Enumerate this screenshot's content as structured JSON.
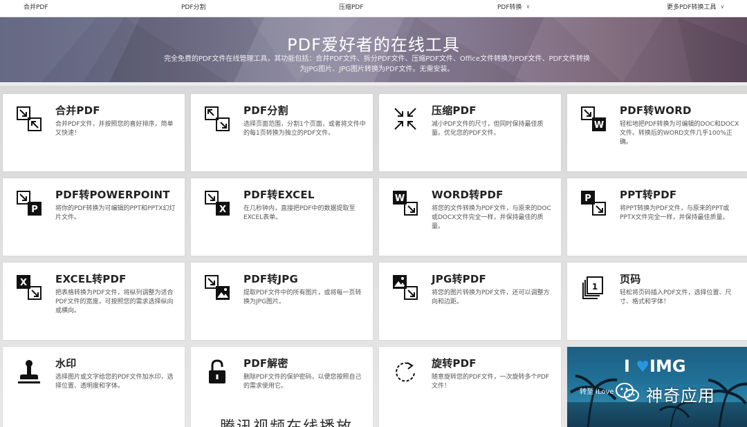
{
  "nav": {
    "items": [
      {
        "label": "合并PDF"
      },
      {
        "label": "PDF分割"
      },
      {
        "label": "压缩PDF"
      },
      {
        "label": "PDF转换"
      },
      {
        "label": "更多PDF转换工具"
      }
    ]
  },
  "hero": {
    "title": "PDF爱好者的在线工具",
    "subtitle": "完全免费的PDF文件在线管理工具，其功能包括：合并PDF文件、拆分PDF文件、压缩PDF文件、Office文件转换为PDF文件、PDF文件转换为JPG图片、JPG图片转换为PDF文件。无需安装。"
  },
  "tools": [
    {
      "title": "合并PDF",
      "desc": "合并PDF文件，并按照您的喜好排序，简单又快速！",
      "icon": "merge-icon"
    },
    {
      "title": "PDF分割",
      "desc": "选择页面范围，分割1个页面，或者将文件中的每1页转换为独立的PDF文件。",
      "icon": "split-icon"
    },
    {
      "title": "压缩PDF",
      "desc": "减小PDF文件的尺寸，但同时保持最佳质量。优化您的PDF文件。",
      "icon": "compress-icon"
    },
    {
      "title": "PDF转WORD",
      "desc": "轻松地把PDF转换为可编辑的DOC和DOCX文件。转换后的WORD文件几乎100%正确。",
      "icon": "word-icon"
    },
    {
      "title": "PDF转POWERPOINT",
      "desc": "将你的PDF转换为可编辑的PPT和PPTX幻灯片文件。",
      "icon": "powerpoint-icon"
    },
    {
      "title": "PDF转EXCEL",
      "desc": "在几秒钟内，直接把PDF中的数据提取至EXCEL表单。",
      "icon": "excel-icon"
    },
    {
      "title": "WORD转PDF",
      "desc": "将您的文件转换为PDF文件，与原来的DOC或DOCX文件完全一样，并保持最佳的质量。",
      "icon": "word-to-pdf-icon"
    },
    {
      "title": "PPT转PDF",
      "desc": "将PPT转换为PDF文件，与原来的PPT或PPTX文件完全一样，并保持最佳质量。",
      "icon": "ppt-to-pdf-icon"
    },
    {
      "title": "EXCEL转PDF",
      "desc": "把表格转换为PDF文件，将纵列调整为适合PDF文件的宽度，可按照您的需求选择纵向或横向。",
      "icon": "excel-to-pdf-icon"
    },
    {
      "title": "PDF转JPG",
      "desc": "提取PDF文件中的所有图片，或将每一页转换为JPG图片。",
      "icon": "pdf-to-jpg-icon"
    },
    {
      "title": "JPG转PDF",
      "desc": "将您的图片转换为PDF文件，还可以调整方向和边距。",
      "icon": "jpg-to-pdf-icon"
    },
    {
      "title": "页码",
      "desc": "轻松将页码插入PDF文件，选择位置、尺寸、格式和字体！",
      "icon": "page-number-icon"
    },
    {
      "title": "水印",
      "desc": "选择图片或文字给您的PDF文件加水印，选择位置、透明度和字体。",
      "icon": "watermark-stamp-icon"
    },
    {
      "title": "PDF解密",
      "desc": "删除PDF文件的保护密码，以便您按照自己的需求使用它。",
      "icon": "unlock-icon"
    },
    {
      "title": "旋转PDF",
      "desc": "随意旋转您的PDF文件，一次旋转多个PDF文件！",
      "icon": "rotate-icon"
    }
  ],
  "promo": {
    "brand_left": "I",
    "brand_right": "IMG",
    "tagline": "转至 iLove"
  },
  "watermark": {
    "text": "神奇应用"
  },
  "caption": {
    "text": "腾讯视频在线播放"
  }
}
